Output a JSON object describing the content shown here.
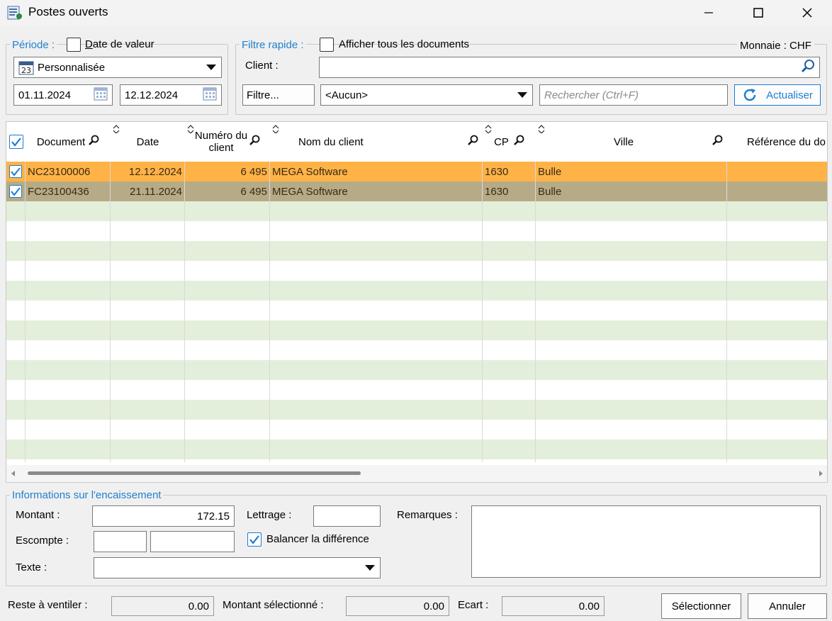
{
  "window": {
    "title": "Postes ouverts"
  },
  "periode": {
    "legend": "Période :",
    "date_valeur_label": "Date de valeur",
    "date_valeur_checked": false,
    "period_select": "Personnalisée",
    "calendar_icon_text": "23",
    "date_from": "01.11.2024",
    "date_to": "12.12.2024"
  },
  "filtre": {
    "legend": "Filtre rapide :",
    "afficher_tous_label": "Afficher tous les documents",
    "afficher_tous_checked": false,
    "monnaie": "Monnaie : CHF",
    "client_label": "Client :",
    "client_value": "",
    "filtre_button": "Filtre...",
    "filter_select": "<Aucun>",
    "search_placeholder": "Rechercher (Ctrl+F)",
    "actualiser_button": "Actualiser"
  },
  "grid": {
    "columns": {
      "document": "Document",
      "date": "Date",
      "numero_client_1": "Numéro du",
      "numero_client_2": "client",
      "nom_client": "Nom du client",
      "cp": "CP",
      "ville": "Ville",
      "reference": "Référence du do"
    },
    "rows": [
      {
        "checked": true,
        "document": "NC23100006",
        "date": "12.12.2024",
        "numero_client": "6 495",
        "nom_client": "MEGA Software",
        "cp": "1630",
        "ville": "Bulle",
        "reference": ""
      },
      {
        "checked": true,
        "document": "FC23100436",
        "date": "21.11.2024",
        "numero_client": "6 495",
        "nom_client": "MEGA Software",
        "cp": "1630",
        "ville": "Bulle",
        "reference": ""
      }
    ]
  },
  "encaissement": {
    "legend": "Informations sur l'encaissement",
    "montant_label": "Montant :",
    "montant_value": "172.15",
    "lettrage_label": "Lettrage :",
    "lettrage_value": "",
    "remarques_label": "Remarques :",
    "remarques_value": "",
    "escompte_label": "Escompte :",
    "escompte_value_1": "",
    "escompte_value_2": "",
    "balancer_label": "Balancer la différence",
    "balancer_checked": true,
    "texte_label": "Texte :",
    "texte_value": ""
  },
  "footer": {
    "reste_label": "Reste  à ventiler :",
    "reste_value": "0.00",
    "montant_sel_label": "Montant sélectionné :",
    "montant_sel_value": "0.00",
    "ecart_label": "Ecart :",
    "ecart_value": "0.00",
    "selectionner_button": "Sélectionner",
    "annuler_button": "Annuler"
  },
  "colors": {
    "accent": "#1f7fd0",
    "row_selected": "#ffb347",
    "row_second": "#b7ab87",
    "row_alt": "#e3efda"
  }
}
